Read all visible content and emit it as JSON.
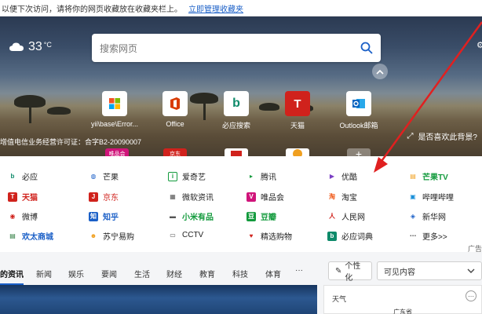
{
  "favorites_bar": {
    "notice": "以便下次访问，请将你的网页收藏放在收藏夹栏上。",
    "link": "立即管理收藏夹"
  },
  "weather": {
    "temp": "33",
    "unit": "°C",
    "icon": "cloud-icon"
  },
  "search": {
    "placeholder": "搜索网页",
    "icon": "search-icon"
  },
  "tiles": [
    {
      "label": "yii\\base\\Error...",
      "icon": "tile-windows-icon"
    },
    {
      "label": "Office",
      "icon": "office-icon"
    },
    {
      "label": "必应搜索",
      "icon": "bing-icon"
    },
    {
      "label": "天猫",
      "icon": "tmall-icon"
    },
    {
      "label": "Outlook邮箱",
      "icon": "outlook-icon"
    }
  ],
  "row2_icons": [
    {
      "label": "唯品会",
      "color": "#d0147a"
    },
    {
      "label": "京东",
      "color": "#d0221c"
    },
    {
      "label": "",
      "color": "#d0221c"
    },
    {
      "label": "",
      "color": "#f0a020"
    },
    {
      "label": "+",
      "color": "#888888"
    }
  ],
  "hero_text": {
    "icp": "增值电信业务经营许可证：合字B2-20090007",
    "like_bg": "是否喜欢此背景?"
  },
  "links": {
    "col1": [
      "必应",
      "天猫",
      "微博",
      "欢太商城"
    ],
    "col2": [
      "芒果TV",
      "京东",
      "知乎",
      "苏宁易购"
    ],
    "col3": [
      "爱奇艺",
      "微软资讯",
      "小米有品",
      "CCTV"
    ],
    "col4": [
      "腾讯",
      "唯品会",
      "豆瓣",
      "精选购物"
    ],
    "col5": [
      "优酷",
      "淘宝",
      "人民网",
      "必应词典"
    ],
    "col6": [
      "芒果TV",
      "哔哩哔哩",
      "新华网",
      "更多>>"
    ],
    "ad": "广告"
  },
  "news": {
    "tabs": [
      "的资讯",
      "新闻",
      "娱乐",
      "要闻",
      "生活",
      "财经",
      "教育",
      "科技",
      "体育",
      "···"
    ],
    "personalize": "个性化",
    "visible_content": "可见内容"
  },
  "weather_card": {
    "title": "天气",
    "location": "广东省"
  },
  "colors": {
    "accent": "#1a5fc7",
    "arrow": "#e02020"
  }
}
